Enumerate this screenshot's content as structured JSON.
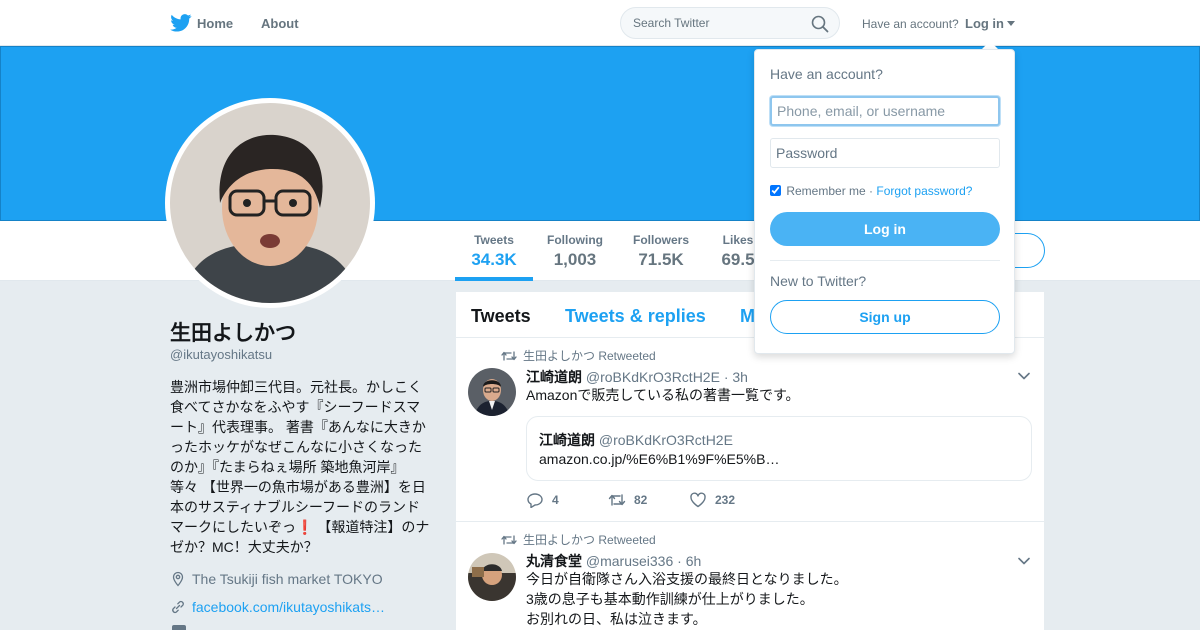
{
  "nav": {
    "home_label": "Home",
    "about_label": "About",
    "search_placeholder": "Search Twitter",
    "have_account_text": "Have an account?",
    "login_label": "Log in"
  },
  "colors": {
    "brand": "#1da1f2",
    "banner": "#1da1f2",
    "text": "#14171a",
    "muted": "#657786"
  },
  "stats": [
    {
      "label": "Tweets",
      "value": "34.3K"
    },
    {
      "label": "Following",
      "value": "1,003"
    },
    {
      "label": "Followers",
      "value": "71.5K"
    },
    {
      "label": "Likes",
      "value": "69.5"
    }
  ],
  "profile": {
    "name": "生田よしかつ",
    "handle": "@ikutayoshikatsu",
    "bio": "豊洲市場仲卸三代目。元社長。かしこく食べてさかなをふやす『シーフードスマート』代表理事。 著書『あんなに大きかったホッケがなぜこんなに小さくなったのか』『たまらねぇ場所 築地魚河岸』等々 【世界一の魚市場がある豊洲】を日本のサスティナブルシーフードのランドマークにしたいぞっ❗️ 【報道特注】のナゼか？MC！大丈夫か？",
    "location": "The Tsukiji fish market TOKYO",
    "url": "facebook.com/ikutayoshikats…"
  },
  "timeline": {
    "tabs": [
      "Tweets",
      "Tweets & replies",
      "M"
    ],
    "tweets": [
      {
        "retweeted_by": "生田よしかつ Retweeted",
        "name": "江崎道朗",
        "handle": "@roBKdKrO3RctH2E",
        "dot": "·",
        "time": "3h",
        "text": "Amazonで販売している私の著書一覧です。",
        "quote": {
          "name": "江崎道朗",
          "handle": "@roBKdKrO3RctH2E",
          "text": "amazon.co.jp/%E6%B1%9F%E5%B…"
        },
        "replies": "4",
        "retweets": "82",
        "likes": "232"
      },
      {
        "retweeted_by": "生田よしかつ Retweeted",
        "name": "丸清食堂",
        "handle": "@marusei336",
        "dot": "·",
        "time": "6h",
        "lines": [
          "今日が自衛隊さん入浴支援の最終日となりました。",
          "3歳の息子も基本動作訓練が仕上がりました。",
          "お別れの日、私は泣きます。"
        ]
      }
    ]
  },
  "login_dropdown": {
    "title": "Have an account?",
    "username_placeholder": "Phone, email, or username",
    "password_placeholder": "Password",
    "remember_label": "Remember me",
    "separator": "·",
    "forgot_label": "Forgot password?",
    "login_button": "Log in",
    "new_text": "New to Twitter?",
    "signup_button": "Sign up"
  }
}
